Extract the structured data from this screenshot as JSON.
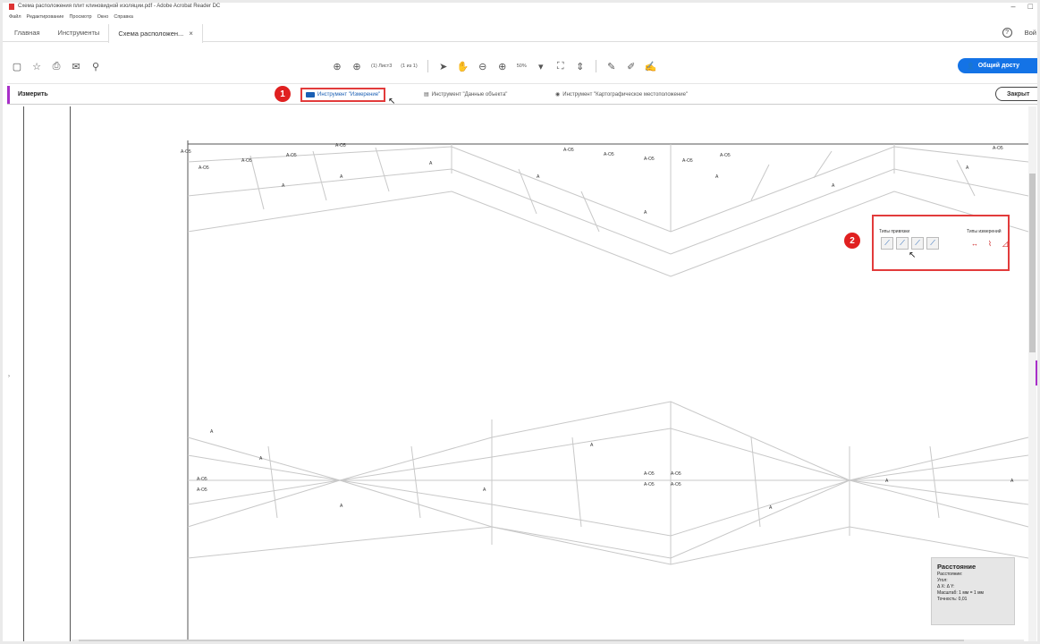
{
  "window": {
    "title": "Схема расположения плит клиновидной изоляции.pdf - Adobe Acrobat Reader DC",
    "minimize": "–",
    "maximize": "□"
  },
  "menu": [
    "Файл",
    "Редактирование",
    "Просмотр",
    "Окно",
    "Справка"
  ],
  "tabs": {
    "home": "Главная",
    "tools": "Инструменты",
    "document": "Схема расположен...",
    "close": "×"
  },
  "header_right": {
    "help": "?",
    "signin": "Вой"
  },
  "toolbar": {
    "page_indicator": "(1) Лист3",
    "page_count": "(1 из 1)",
    "zoom": "50%",
    "share_label": "Общий досту"
  },
  "measure_bar": {
    "label": "Измерить",
    "tool_measure": "Инструмент \"Измерение\"",
    "tool_object_data": "Инструмент \"Данные объекта\"",
    "tool_geo": "Инструмент \"Картографическое местоположение\"",
    "close": "Закрыт"
  },
  "badges": {
    "one": "1",
    "two": "2"
  },
  "snap_panel": {
    "snap_types": "Типы привязки",
    "measure_types": "Типы измерений"
  },
  "distance_panel": {
    "title": "Расстояние",
    "line1": "Расстояние:",
    "line2": "Угол:",
    "line3": "Δ X:     Δ Y:",
    "line4": "Масштаб: 1 мм = 1 мм",
    "line5": "Точность: 0,01"
  },
  "drawing": {
    "label_small": "А",
    "label_a05": "А-О5"
  },
  "colors": {
    "accent": "#1473e6",
    "highlight_red": "#e23b3b",
    "measure_purple": "#a82fc9"
  }
}
